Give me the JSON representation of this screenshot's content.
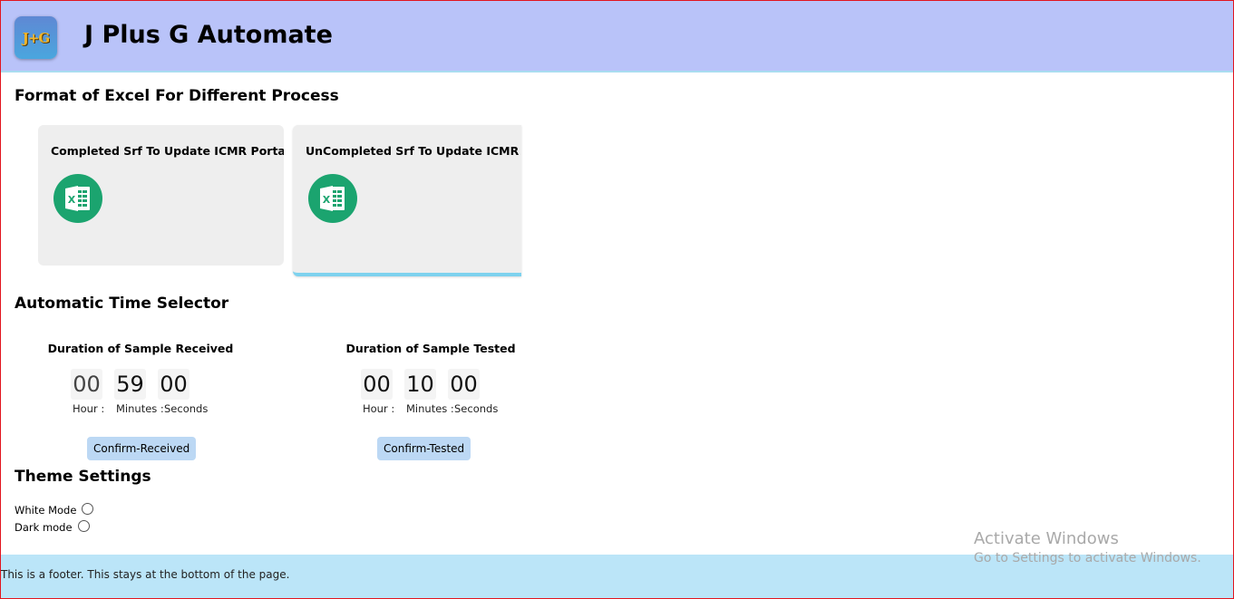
{
  "header": {
    "title": "J Plus G Automate",
    "logo_text": "J+G"
  },
  "excel_section": {
    "title": "Format of Excel For Different Process",
    "cards": [
      {
        "title": "Completed Srf To Update ICMR Portal",
        "icon": "excel-icon"
      },
      {
        "title": "UnCompleted Srf To Update ICMR Portal",
        "icon": "excel-icon"
      }
    ]
  },
  "time_section": {
    "title": "Automatic Time Selector",
    "received": {
      "title": "Duration of Sample Received",
      "hour": "00",
      "minutes": "59",
      "seconds": "00",
      "hour_label": "Hour :",
      "minutes_label": "Minutes :",
      "seconds_label": "Seconds",
      "button": "Confirm-Received"
    },
    "tested": {
      "title": "Duration of Sample Tested",
      "hour": "00",
      "minutes": "10",
      "seconds": "00",
      "hour_label": "Hour :",
      "minutes_label": "Minutes :",
      "seconds_label": "Seconds",
      "button": "Confirm-Tested"
    }
  },
  "theme_section": {
    "title": "Theme Settings",
    "options": [
      {
        "label": "White Mode"
      },
      {
        "label": "Dark mode"
      }
    ]
  },
  "watermark": {
    "line1": "Activate Windows",
    "line2": "Go to Settings to activate Windows."
  },
  "footer": {
    "text": "This is a footer. This stays at the bottom of the page."
  },
  "colors": {
    "header_bg": "#b9c3f9",
    "footer_bg": "#bbe5f8",
    "card_bg": "#eeeeee",
    "button_bg": "#bcd8f4",
    "excel_green": "#1ba46f"
  }
}
